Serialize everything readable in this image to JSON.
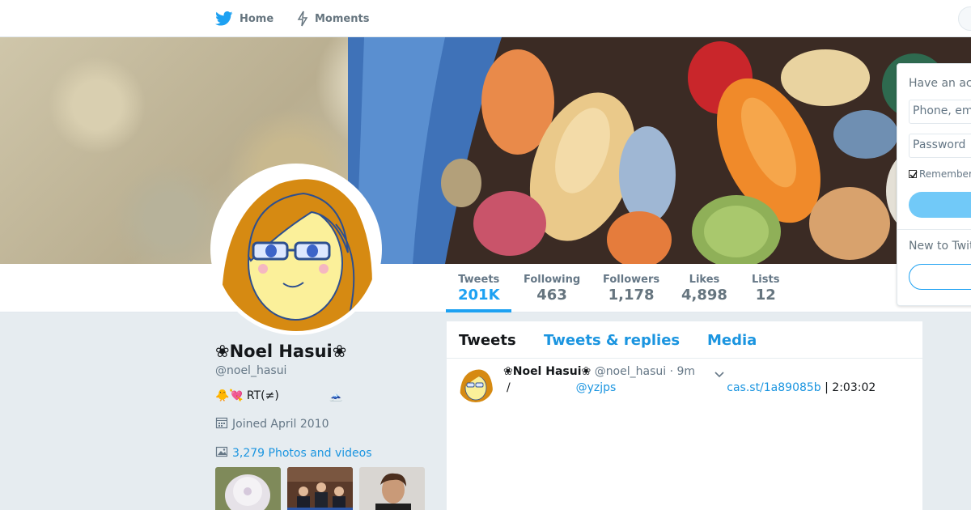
{
  "nav": {
    "home_label": "Home",
    "moments_label": "Moments",
    "brand_color": "#1da1f2"
  },
  "profile": {
    "display_name": "❀Noel Hasui❀",
    "handle": "@noel_hasui",
    "bio": "RT(≠)",
    "bio_emoji_left": "🐥💘",
    "bio_emoji_right": "🗻",
    "joined": "Joined April 2010",
    "photos_videos": "3,279 Photos and videos"
  },
  "stats": [
    {
      "label": "Tweets",
      "value": "201K",
      "active": true
    },
    {
      "label": "Following",
      "value": "463",
      "active": false
    },
    {
      "label": "Followers",
      "value": "1,178",
      "active": false
    },
    {
      "label": "Likes",
      "value": "4,898",
      "active": false
    },
    {
      "label": "Lists",
      "value": "12",
      "active": false
    }
  ],
  "timeline": {
    "tabs": [
      "Tweets",
      "Tweets & replies",
      "Media"
    ],
    "tweets": [
      {
        "name": "❀Noel Hasui❀",
        "handle": "@noel_hasui",
        "time": "· 9m",
        "prefix": "/",
        "mention": "@yzjps",
        "link": "cas.st/1a89085b",
        "suffix": "| 2:03:02"
      }
    ]
  },
  "login": {
    "title": "Have an ac",
    "phone_placeholder": "Phone, em",
    "password_placeholder": "Password",
    "remember": "Remember",
    "new_title": "New to Twit"
  }
}
